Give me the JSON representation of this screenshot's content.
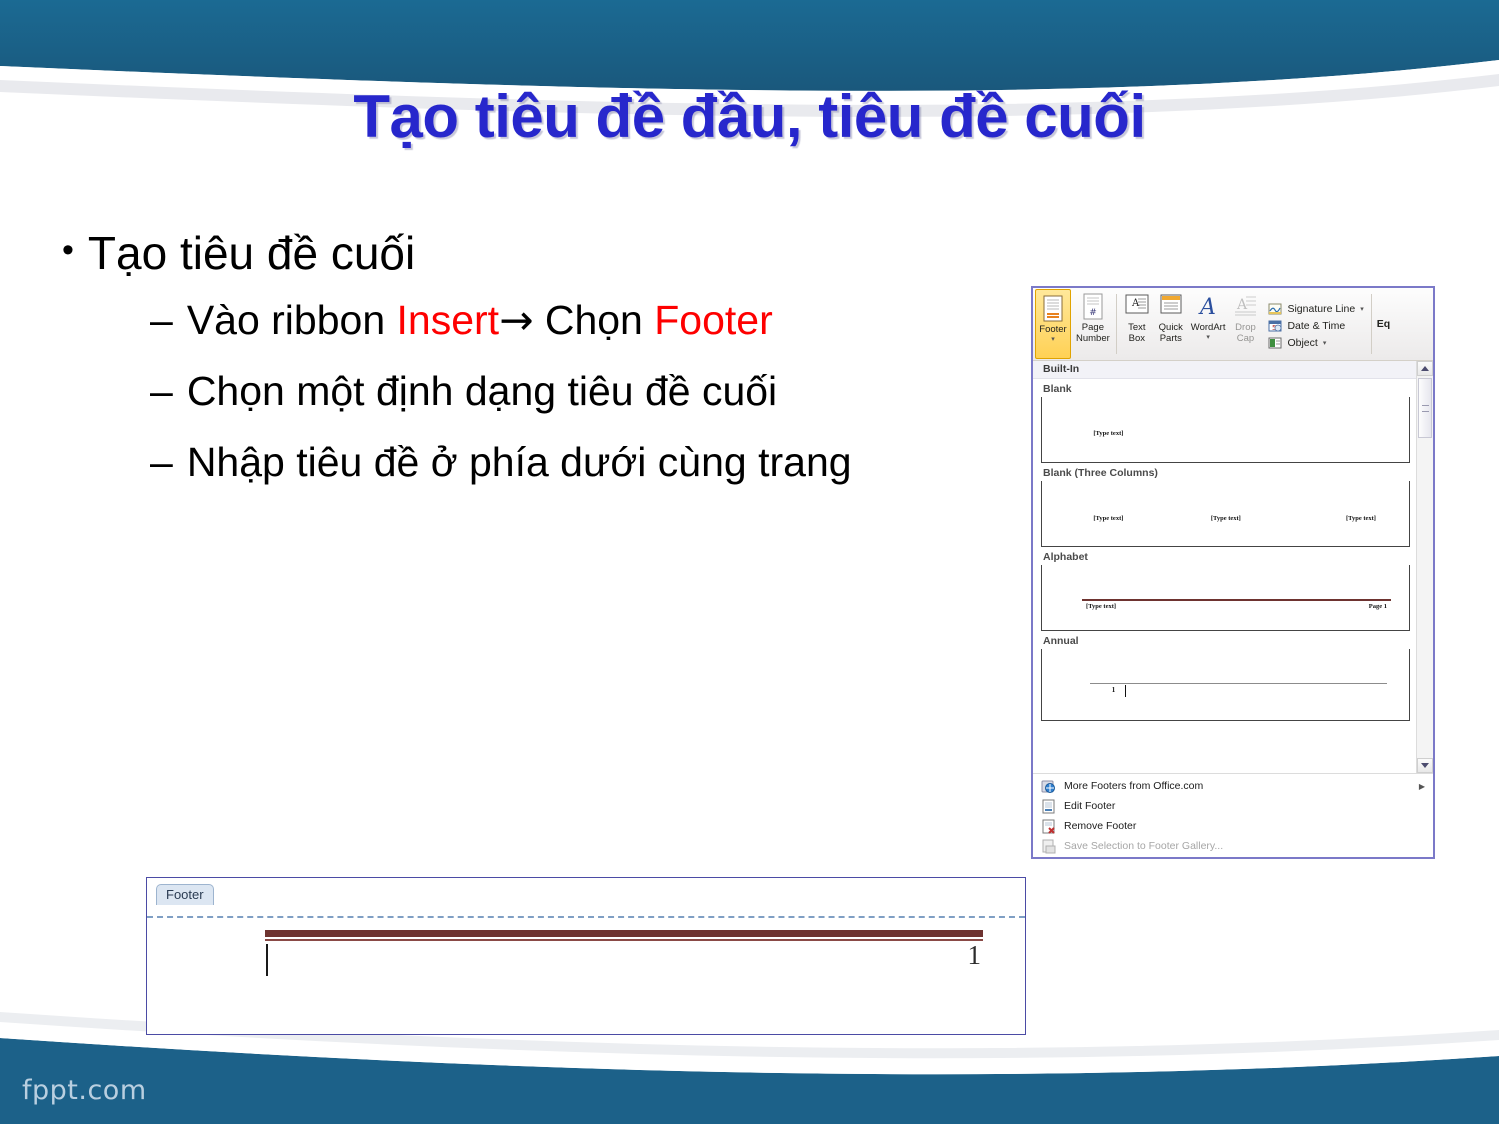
{
  "slide": {
    "title": "Tạo tiêu đề đầu, tiêu đề cuối",
    "brand": "fppt.com",
    "colors": {
      "title_blue": "#2727CC",
      "banner_blue": "#1C6189",
      "accent_red": "#FE0000",
      "maroon_rule": "#6E3330",
      "panel_border": "#7B79C8"
    }
  },
  "outline": {
    "bullet_glyph": "•",
    "dash_glyph": "–",
    "arrow_glyph": "→",
    "level1": "Tạo tiêu đề cuối",
    "level2": [
      {
        "prefix": "Vào ribbon ",
        "highlight1": "Insert",
        "middle": " Chọn ",
        "highlight2": "Footer"
      },
      {
        "text": "Chọn một định dạng tiêu đề cuối"
      },
      {
        "text": "Nhập tiêu đề ở phía dưới cùng trang"
      }
    ]
  },
  "word_panel": {
    "ribbon": {
      "buttons": [
        {
          "label_line1": "Footer",
          "label_line2": "",
          "icon": "footer-icon",
          "state": "active",
          "has_caret": true
        },
        {
          "label_line1": "Page",
          "label_line2": "Number",
          "icon": "page-number-icon",
          "state": "normal",
          "has_caret": true
        },
        {
          "label_line1": "Text",
          "label_line2": "Box",
          "icon": "text-box-icon",
          "state": "normal",
          "has_caret": true
        },
        {
          "label_line1": "Quick",
          "label_line2": "Parts",
          "icon": "quick-parts-icon",
          "state": "normal",
          "has_caret": true
        },
        {
          "label_line1": "WordArt",
          "label_line2": "",
          "icon": "wordart-icon",
          "state": "normal",
          "has_caret": true
        },
        {
          "label_line1": "Drop",
          "label_line2": "Cap",
          "icon": "drop-cap-icon",
          "state": "disabled",
          "has_caret": true
        }
      ],
      "small_commands": [
        {
          "label": "Signature Line",
          "icon": "signature-line-icon",
          "has_caret": true
        },
        {
          "label": "Date & Time",
          "icon": "date-time-icon",
          "has_caret": false
        },
        {
          "label": "Object",
          "icon": "object-icon",
          "has_caret": true
        }
      ],
      "edge_label": "Eq"
    },
    "gallery": {
      "header": "Built-In",
      "items": [
        {
          "name": "Blank",
          "type": "single",
          "placeholders": [
            "[Type text]"
          ]
        },
        {
          "name": "Blank (Three Columns)",
          "type": "three-column",
          "placeholders": [
            "[Type text]",
            "[Type text]",
            "[Type text]"
          ]
        },
        {
          "name": "Alphabet",
          "type": "alphabet",
          "placeholders": [
            "[Type text]"
          ],
          "page_label": "Page 1"
        },
        {
          "name": "Annual",
          "type": "annual",
          "number": "1"
        }
      ]
    },
    "menu": [
      {
        "label": "More Footers from Office.com",
        "icon": "office-online-icon",
        "disabled": false,
        "submenu": true,
        "accel": "M"
      },
      {
        "label": "Edit Footer",
        "icon": "edit-footer-icon",
        "disabled": false,
        "submenu": false,
        "accel": "E"
      },
      {
        "label": "Remove Footer",
        "icon": "remove-footer-icon",
        "disabled": false,
        "submenu": false,
        "accel": "R"
      },
      {
        "label": "Save Selection to Footer Gallery...",
        "icon": "save-gallery-icon",
        "disabled": true,
        "submenu": false,
        "accel": "S"
      }
    ]
  },
  "doc_demo": {
    "tab_label": "Footer",
    "page_number": "1"
  }
}
